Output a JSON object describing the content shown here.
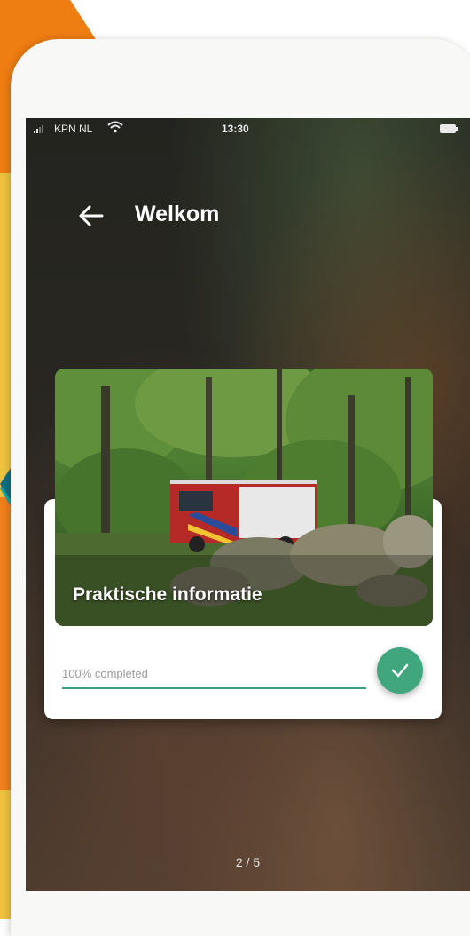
{
  "status_bar": {
    "carrier": "KPN NL",
    "time": "13:30"
  },
  "header": {
    "title": "Welkom",
    "back_icon": "arrow-left-icon"
  },
  "card": {
    "title": "Praktische informatie",
    "progress_label": "100% completed",
    "progress_percent": 100,
    "status_icon": "checkmark-icon",
    "accent_color": "#3fa67e"
  },
  "pager": {
    "label": "2 / 5"
  }
}
